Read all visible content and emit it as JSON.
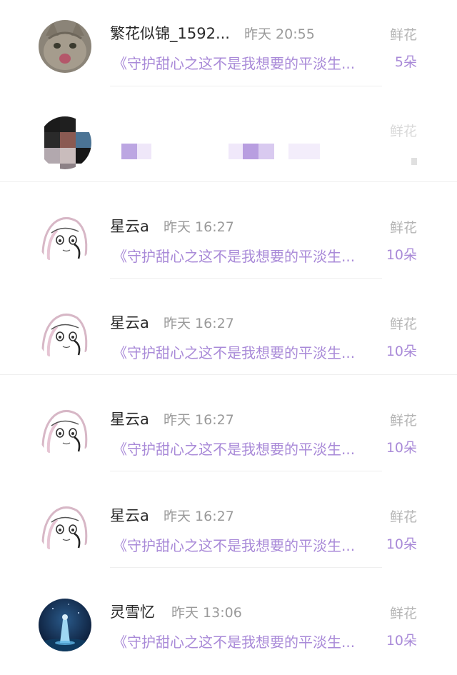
{
  "items": [
    {
      "name": "繁花似锦_1592...",
      "time": "昨天 20:55",
      "type": "鲜花",
      "title": "《守护甜心之这不是我想要的平淡生...",
      "count": "5朵",
      "avatar_icon": "cat-avatar-icon"
    },
    {
      "name": "",
      "time": "",
      "type": "鲜花",
      "title": "",
      "count": "",
      "avatar_icon": "pixelated-avatar-icon"
    },
    {
      "name": "星云a",
      "time": "昨天 16:27",
      "type": "鲜花",
      "title": "《守护甜心之这不是我想要的平淡生...",
      "count": "10朵",
      "avatar_icon": "anime-girl-avatar-icon"
    },
    {
      "name": "星云a",
      "time": "昨天 16:27",
      "type": "鲜花",
      "title": "《守护甜心之这不是我想要的平淡生...",
      "count": "10朵",
      "avatar_icon": "anime-girl-avatar-icon"
    },
    {
      "name": "星云a",
      "time": "昨天 16:27",
      "type": "鲜花",
      "title": "《守护甜心之这不是我想要的平淡生...",
      "count": "10朵",
      "avatar_icon": "anime-girl-avatar-icon"
    },
    {
      "name": "星云a",
      "time": "昨天 16:27",
      "type": "鲜花",
      "title": "《守护甜心之这不是我想要的平淡生...",
      "count": "10朵",
      "avatar_icon": "anime-girl-avatar-icon"
    },
    {
      "name": "灵雪忆",
      "time": "昨天 13:06",
      "type": "鲜花",
      "title": "《守护甜心之这不是我想要的平淡生...",
      "count": "10朵",
      "avatar_icon": "night-scene-avatar-icon"
    }
  ],
  "colors": {
    "accent": "#a98ad8",
    "name": "#2a2a2a",
    "muted": "#9a9a9a"
  }
}
